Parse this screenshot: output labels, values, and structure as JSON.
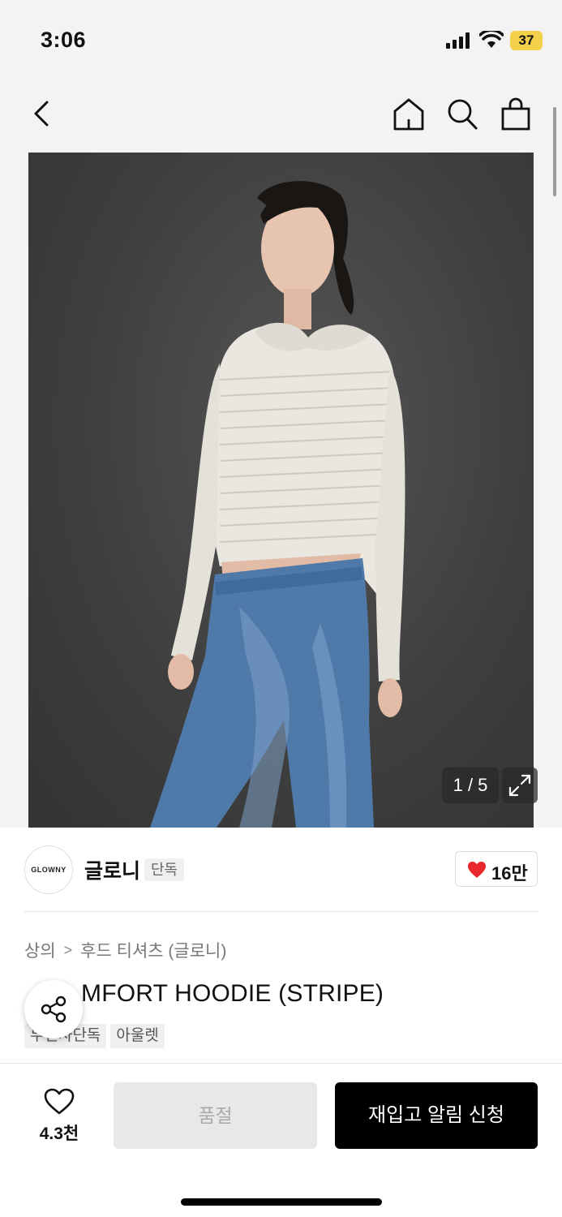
{
  "status_bar": {
    "time": "3:06",
    "battery": "37"
  },
  "nav": {
    "back_icon": "chevron-left-icon",
    "home_icon": "home-icon",
    "search_icon": "search-icon",
    "cart_icon": "shopping-bag-icon"
  },
  "gallery": {
    "pager": "1 / 5",
    "current": 1,
    "total": 5,
    "expand_icon": "expand-icon"
  },
  "brand": {
    "logo_text": "GLOWNY",
    "name": "글로니",
    "badge": "단독",
    "like_count": "16만",
    "like_icon": "heart-filled-icon"
  },
  "breadcrumb": {
    "items": [
      "상의",
      "후드 티셔츠 (글로니)"
    ],
    "separator": ">"
  },
  "product": {
    "title_visible": "MFORT HOODIE (STRIPE)",
    "tags": [
      "무신사단독",
      "아울렛"
    ]
  },
  "share": {
    "icon": "share-icon"
  },
  "bottom_bar": {
    "wish_count": "4.3천",
    "wish_icon": "heart-outline-icon",
    "soldout_label": "품절",
    "restock_label": "재입고 알림 신청"
  },
  "colors": {
    "accent": "#000000",
    "heart": "#e8282d",
    "battery": "#f2d04a",
    "soldout_bg": "#e8e8e8"
  }
}
